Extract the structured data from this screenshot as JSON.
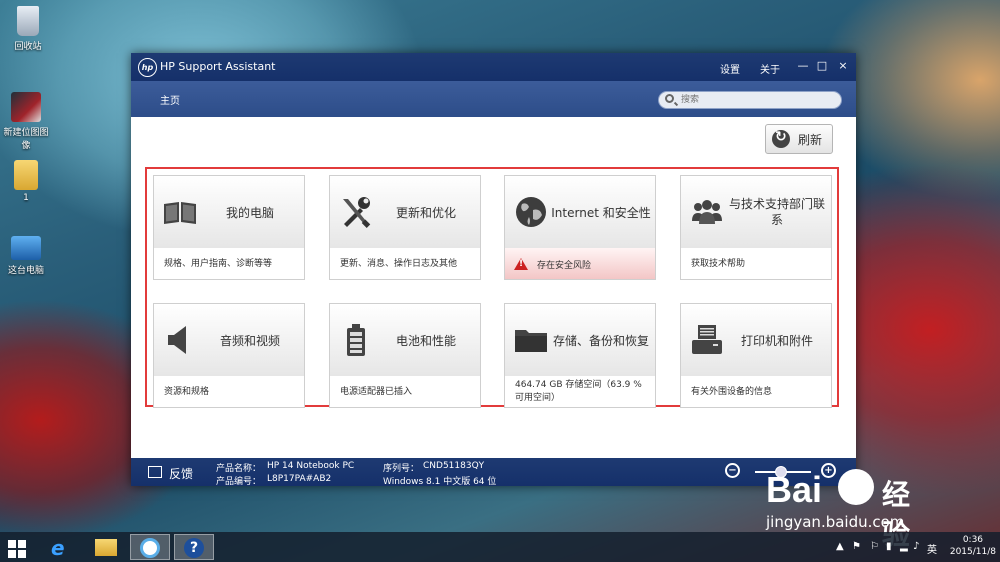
{
  "desktop": {
    "icons": [
      {
        "label": "回收站"
      },
      {
        "label": "新建位图图像"
      },
      {
        "label": "1"
      },
      {
        "label": "这台电脑"
      }
    ]
  },
  "window": {
    "title": "HP Support Assistant",
    "logo": "hp",
    "menu": {
      "settings": "设置",
      "about": "关于"
    },
    "controls": {
      "minimize": "—",
      "maximize": "□",
      "close": "×"
    },
    "nav": {
      "home": "主页"
    },
    "search": {
      "placeholder": "搜索"
    },
    "refresh": {
      "label": "刷新"
    },
    "tiles": [
      {
        "title": "我的电脑",
        "desc": "规格、用户指南、诊断等等",
        "icon": "book-icon"
      },
      {
        "title": "更新和优化",
        "desc": "更新、消息、操作日志及其他",
        "icon": "tools-icon"
      },
      {
        "title": "Internet 和安全性",
        "desc": "存在安全风险",
        "icon": "globe-icon",
        "alert": true
      },
      {
        "title": "与技术支持部门联系",
        "desc": "获取技术帮助",
        "icon": "people-icon"
      },
      {
        "title": "音频和视频",
        "desc": "资源和规格",
        "icon": "speaker-icon"
      },
      {
        "title": "电池和性能",
        "desc": "电源适配器已插入",
        "icon": "battery-icon"
      },
      {
        "title": "存储、备份和恢复",
        "desc": "464.74 GB 存储空间（63.9 % 可用空间）",
        "icon": "folder-icon"
      },
      {
        "title": "打印机和附件",
        "desc": "有关外围设备的信息",
        "icon": "printer-icon"
      }
    ],
    "status": {
      "feedback": "反馈",
      "product_name_label": "产品名称：",
      "product_name": "HP 14 Notebook PC",
      "product_number_label": "产品编号：",
      "product_number": "L8P17PA#AB2",
      "serial_label": "序列号：",
      "serial": "CND51183QY",
      "os": "Windows 8.1 中文版 64 位"
    }
  },
  "taskbar": {
    "tray_lang": "英",
    "time": "0:36",
    "date": "2015/11/8"
  },
  "watermark": {
    "brand": "Bai",
    "brand2": "经验",
    "url": "jingyan.baidu.com"
  }
}
